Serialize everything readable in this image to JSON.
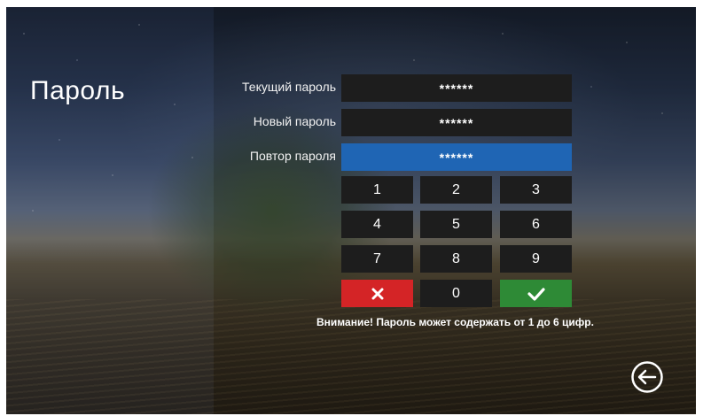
{
  "title": "Пароль",
  "fields": [
    {
      "label": "Текущий пароль",
      "value": "******",
      "active": false
    },
    {
      "label": "Новый пароль",
      "value": "******",
      "active": false
    },
    {
      "label": "Повтор пароля",
      "value": "******",
      "active": true
    }
  ],
  "keypad": {
    "row1": [
      "1",
      "2",
      "3"
    ],
    "row2": [
      "4",
      "5",
      "6"
    ],
    "row3": [
      "7",
      "8",
      "9"
    ],
    "zero": "0"
  },
  "icons": {
    "cancel": "close-icon",
    "confirm": "checkmark-icon",
    "back": "back-arrow-icon"
  },
  "colors": {
    "active_field": "#1f65b4",
    "cancel": "#d42426",
    "confirm": "#2e8a36",
    "key_bg": "#1d1d1d"
  },
  "warning": "Внимание! Пароль может содержать от 1 до 6 цифр."
}
